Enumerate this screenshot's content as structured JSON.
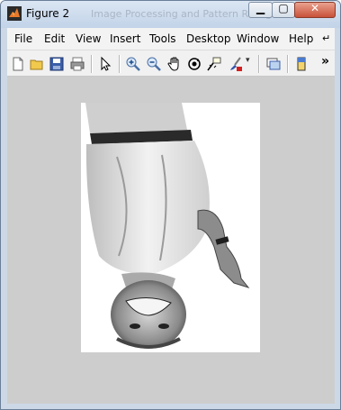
{
  "window": {
    "title": "Figure 2",
    "background_title": "Image Processing and Pattern Recognition"
  },
  "menu": [
    "File",
    "Edit",
    "View",
    "Insert",
    "Tools",
    "Desktop",
    "Window",
    "Help"
  ],
  "menu_overflow": "↵",
  "toolbar_overflow": "»",
  "toolbar_icons": [
    "new-figure-icon",
    "open-file-icon",
    "save-icon",
    "print-icon",
    "edit-plot-arrow-icon",
    "zoom-in-icon",
    "zoom-out-icon",
    "pan-hand-icon",
    "rotate-3d-icon",
    "data-cursor-icon",
    "brush-icon",
    "link-plot-icon",
    "colorbar-icon"
  ],
  "colors": {
    "figure_bg": "#cdcdcd",
    "axes_bg": "#ffffff",
    "title_bar": "#c8d7ea"
  }
}
